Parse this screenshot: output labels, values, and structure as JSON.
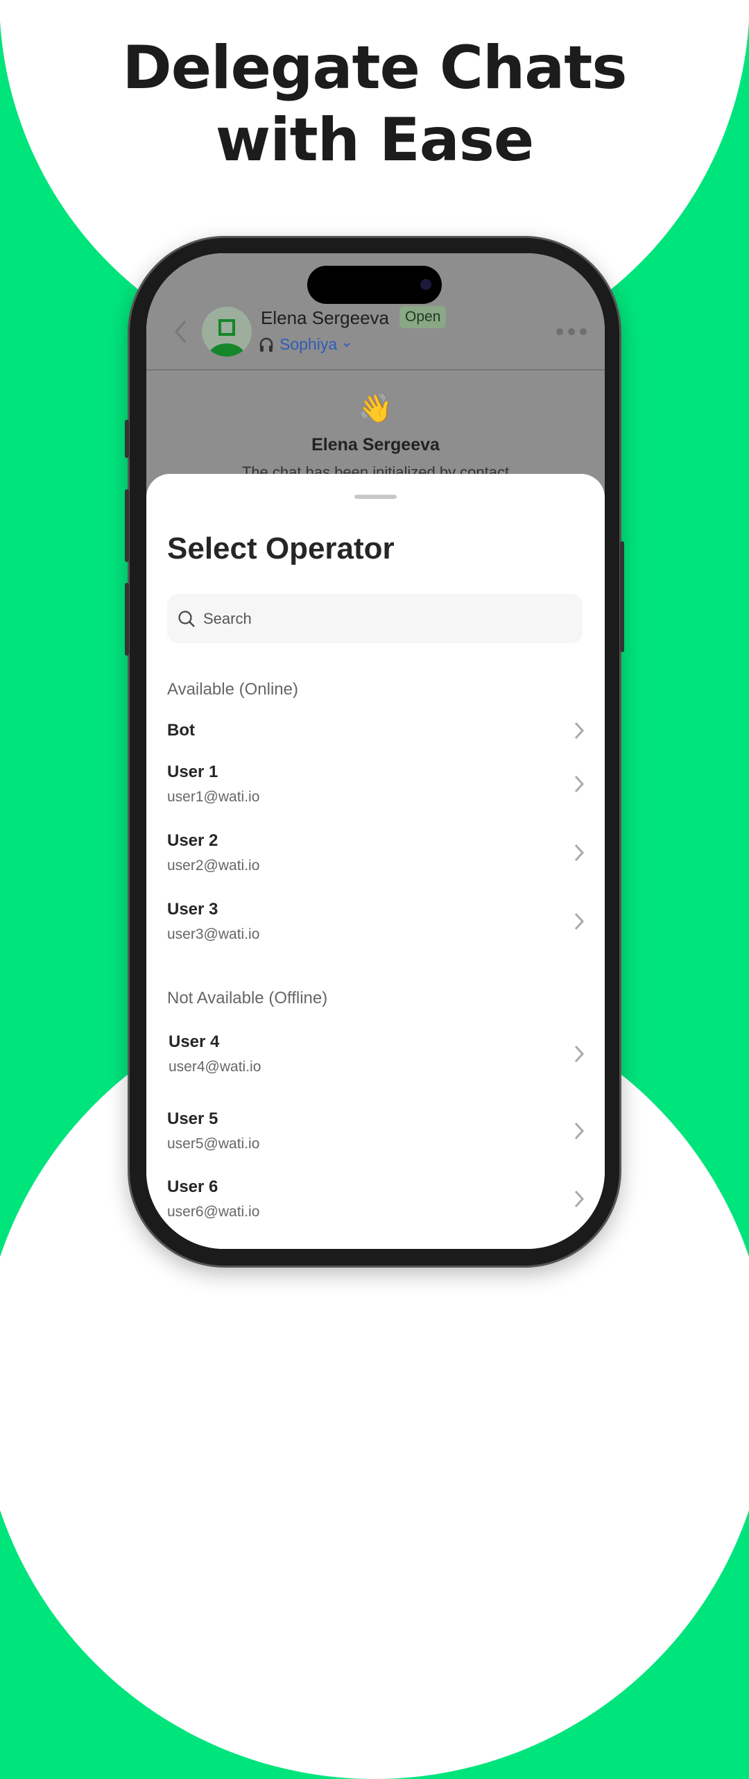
{
  "headline": {
    "line1": "Delegate Chats",
    "line2": "with Ease"
  },
  "colors": {
    "brand_green": "#00e47c",
    "link_blue": "#2d5db5"
  },
  "chat_header": {
    "contact_name": "Elena Sergeeva",
    "status_badge": "Open",
    "assigned_agent": "Sophiya",
    "back_icon": "chevron-left-icon",
    "more_icon": "more-horizontal-icon",
    "agent_icon": "headset-icon"
  },
  "chat_body": {
    "emoji": "👋",
    "contact_name": "Elena Sergeeva",
    "message": "The chat has been initialized by contact"
  },
  "sheet": {
    "title": "Select Operator",
    "search": {
      "placeholder": "Search",
      "value": ""
    },
    "online_section": {
      "label": "Available (Online)",
      "items": [
        {
          "name": "Bot"
        },
        {
          "name": "User 1",
          "email": "user1@wati.io"
        },
        {
          "name": "User 2",
          "email": "user2@wati.io"
        },
        {
          "name": "User 3",
          "email": "user3@wati.io"
        }
      ]
    },
    "offline_section": {
      "label": "Not Available (Offline)",
      "items": [
        {
          "name": "User 4",
          "email": "user4@wati.io"
        },
        {
          "name": "User 5",
          "email": "user5@wati.io"
        },
        {
          "name": "User 6",
          "email": "user6@wati.io"
        }
      ]
    }
  }
}
